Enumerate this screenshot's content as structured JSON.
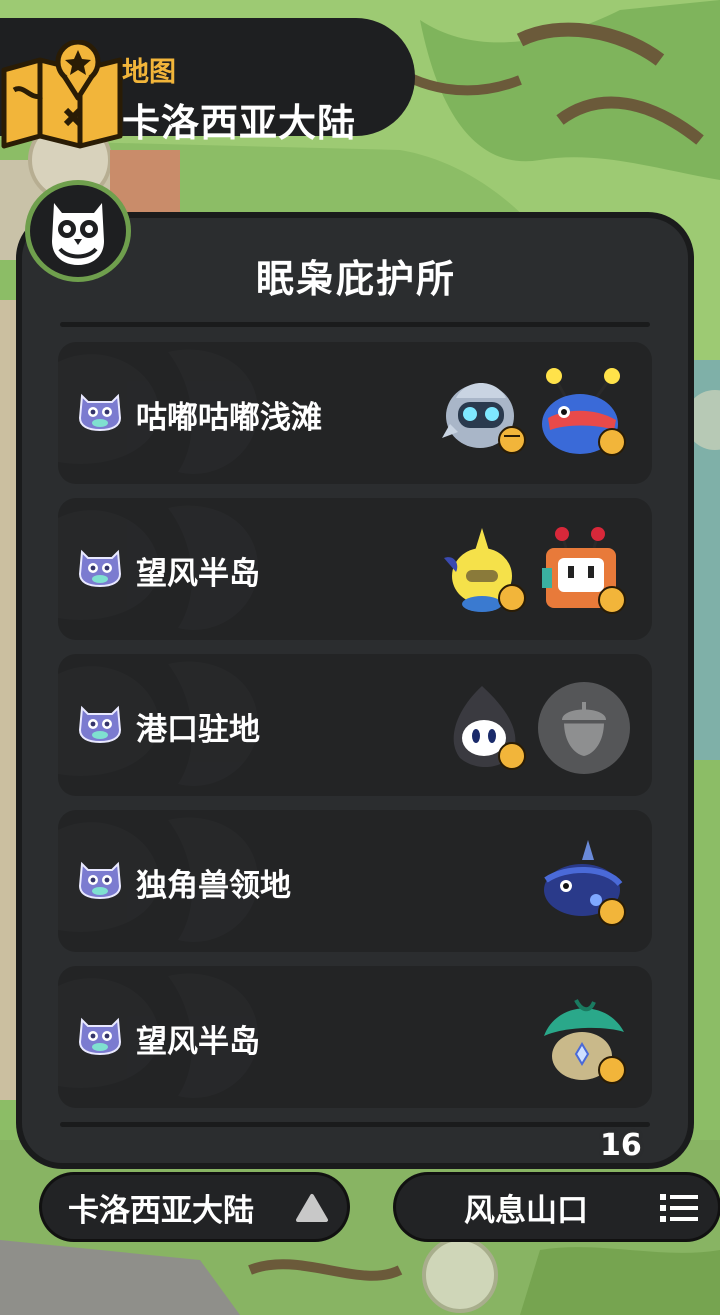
{
  "header": {
    "map_label": "地图",
    "region_title": "卡洛西亚大陆",
    "icon": "treasure-map-icon"
  },
  "panel": {
    "title": "眠枭庇护所",
    "badge_icon": "owl-icon",
    "rows": [
      {
        "label": "咕嘟咕嘟浅滩",
        "pets": [
          "pet-ghost-blue",
          "pet-fish-antenna"
        ]
      },
      {
        "label": "望风半岛",
        "pets": [
          "pet-yellow-sprite",
          "pet-robot-box"
        ]
      },
      {
        "label": "港口驻地",
        "pets": [
          "pet-dark-ghost",
          "empty-acorn-slot"
        ]
      },
      {
        "label": "独角兽领地",
        "pets": [
          "pet-horned-fish"
        ]
      },
      {
        "label": "望风半岛",
        "pets": [
          "pet-leaf-hat"
        ]
      }
    ]
  },
  "bottom": {
    "left_button": "卡洛西亚大陆",
    "right_button": "风息山口",
    "floor_number": "16"
  },
  "colors": {
    "panel_bg": "#2b2d2f",
    "row_bg": "#232425",
    "accent_gold": "#f2b53a",
    "owl_purple": "#6f6fc8"
  }
}
